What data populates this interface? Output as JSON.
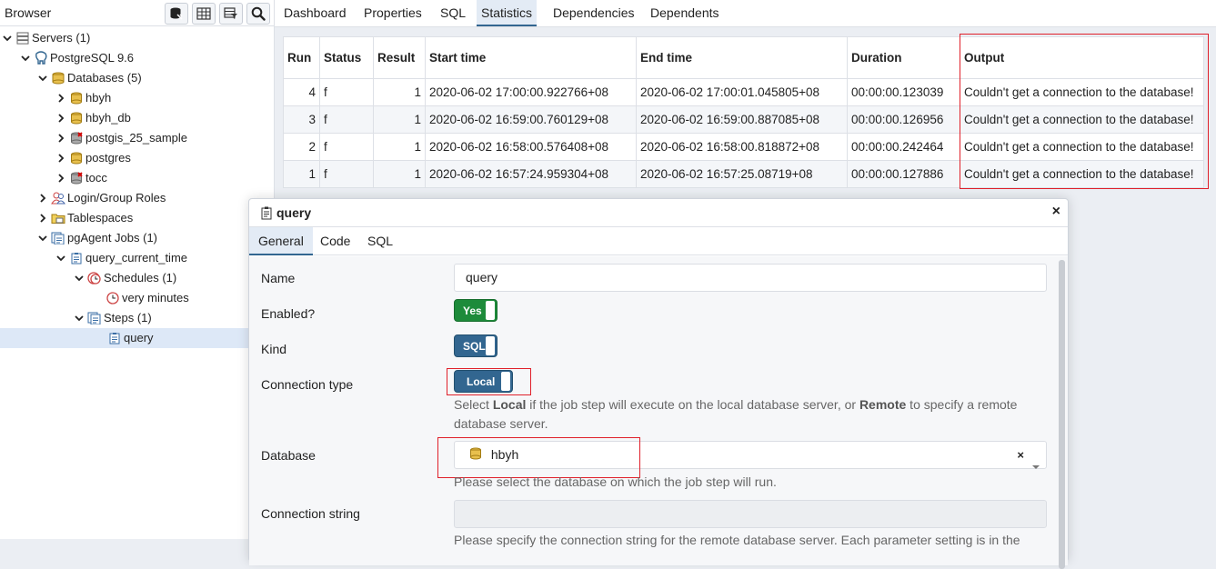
{
  "browser": {
    "title": "Browser",
    "tree": [
      {
        "label": "Servers (1)",
        "icon": "servers-icon"
      },
      {
        "label": "PostgreSQL 9.6",
        "icon": "postgres-elephant-icon"
      },
      {
        "label": "Databases (5)",
        "icon": "databases-icon"
      },
      {
        "label": "hbyh",
        "icon": "database-icon"
      },
      {
        "label": "hbyh_db",
        "icon": "database-icon"
      },
      {
        "label": "postgis_25_sample",
        "icon": "database-disconnected-icon"
      },
      {
        "label": "postgres",
        "icon": "database-icon"
      },
      {
        "label": "tocc",
        "icon": "database-disconnected-icon"
      },
      {
        "label": "Login/Group Roles",
        "icon": "roles-icon"
      },
      {
        "label": "Tablespaces",
        "icon": "tablespaces-icon"
      },
      {
        "label": "pgAgent Jobs (1)",
        "icon": "jobs-icon"
      },
      {
        "label": "query_current_time",
        "icon": "job-icon"
      },
      {
        "label": "Schedules (1)",
        "icon": "schedules-icon"
      },
      {
        "label": "very minutes",
        "icon": "schedule-icon"
      },
      {
        "label": "Steps (1)",
        "icon": "steps-icon"
      },
      {
        "label": "query",
        "icon": "step-icon"
      }
    ]
  },
  "main_tabs": [
    "Dashboard",
    "Properties",
    "SQL",
    "Statistics",
    "Dependencies",
    "Dependents"
  ],
  "stats": {
    "headers": [
      "Run",
      "Status",
      "Result",
      "Start time",
      "End time",
      "Duration",
      "Output"
    ],
    "rows": [
      [
        "4",
        "f",
        "1",
        "2020-06-02 17:00:00.922766+08",
        "2020-06-02 17:00:01.045805+08",
        "00:00:00.123039",
        "Couldn't get a connection to the database!"
      ],
      [
        "3",
        "f",
        "1",
        "2020-06-02 16:59:00.760129+08",
        "2020-06-02 16:59:00.887085+08",
        "00:00:00.126956",
        "Couldn't get a connection to the database!"
      ],
      [
        "2",
        "f",
        "1",
        "2020-06-02 16:58:00.576408+08",
        "2020-06-02 16:58:00.818872+08",
        "00:00:00.242464",
        "Couldn't get a connection to the database!"
      ],
      [
        "1",
        "f",
        "1",
        "2020-06-02 16:57:24.959304+08",
        "2020-06-02 16:57:25.08719+08",
        "00:00:00.127886",
        "Couldn't get a connection to the database!"
      ]
    ]
  },
  "dialog": {
    "title": "query",
    "close": "×",
    "tabs": [
      "General",
      "Code",
      "SQL"
    ],
    "name_label": "Name",
    "name_value": "query",
    "enabled_label": "Enabled?",
    "enabled_value": "Yes",
    "kind_label": "Kind",
    "kind_value": "SQL",
    "conn_type_label": "Connection type",
    "conn_type_value": "Local",
    "conn_help_1": "Select ",
    "conn_help_local": "Local",
    "conn_help_2": " if the job step will execute on the local database server, or ",
    "conn_help_remote": "Remote",
    "conn_help_3": " to specify a remote database server.",
    "database_label": "Database",
    "database_value": "hbyh",
    "database_clear": "×",
    "database_help": "Please select the database on which the job step will run.",
    "conn_string_label": "Connection string",
    "conn_string_help": "Please specify the connection string for the remote database server. Each parameter setting is in the"
  },
  "colors": {
    "accent": "#326690",
    "toggle_yes": "#1d8b3a",
    "toggle_sql": "#326690",
    "highlight_box": "#e0202a"
  }
}
